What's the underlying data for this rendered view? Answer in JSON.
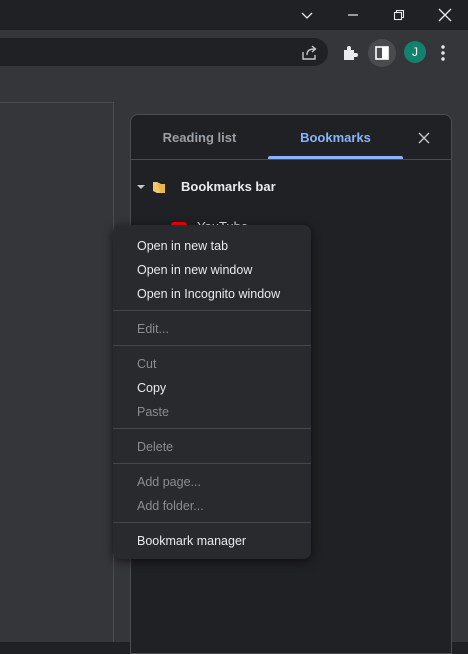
{
  "window": {
    "controls": [
      "tab-search",
      "minimize",
      "restore",
      "close"
    ]
  },
  "toolbar": {
    "avatar_letter": "J",
    "icons": [
      "share-icon",
      "extensions-icon",
      "side-panel-icon",
      "menu-icon"
    ]
  },
  "side_panel": {
    "tabs": [
      {
        "label": "Reading list",
        "selected": false
      },
      {
        "label": "Bookmarks",
        "selected": true
      }
    ],
    "folder": {
      "label": "Bookmarks bar"
    },
    "items": [
      {
        "label": "YouTube"
      }
    ]
  },
  "context_menu": {
    "groups": [
      [
        {
          "label": "Open in new tab",
          "enabled": true
        },
        {
          "label": "Open in new window",
          "enabled": true
        },
        {
          "label": "Open in Incognito window",
          "enabled": true
        }
      ],
      [
        {
          "label": "Edit...",
          "enabled": false
        }
      ],
      [
        {
          "label": "Cut",
          "enabled": false
        },
        {
          "label": "Copy",
          "enabled": true
        },
        {
          "label": "Paste",
          "enabled": false
        }
      ],
      [
        {
          "label": "Delete",
          "enabled": false
        }
      ],
      [
        {
          "label": "Add page...",
          "enabled": false
        },
        {
          "label": "Add folder...",
          "enabled": false
        }
      ],
      [
        {
          "label": "Bookmark manager",
          "enabled": true
        }
      ]
    ]
  },
  "colors": {
    "accent": "#8ab4f8",
    "panel_bg": "#202124",
    "menu_bg": "#292a2d",
    "avatar": "#12826e"
  }
}
